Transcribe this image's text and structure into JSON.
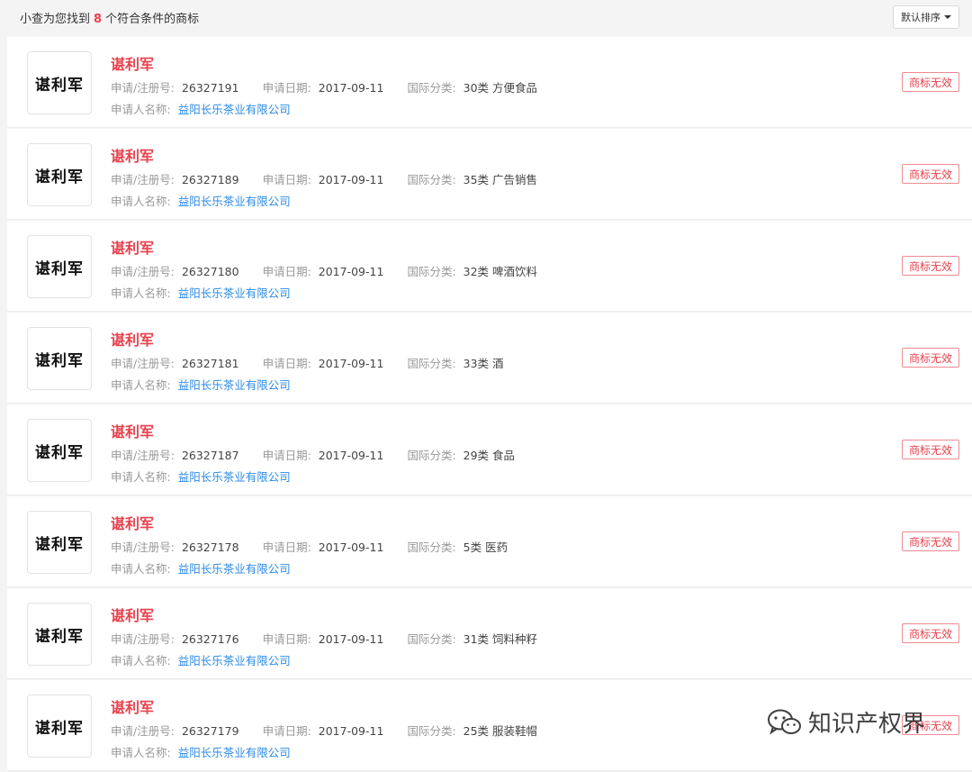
{
  "header": {
    "prefix": "小查为您找到",
    "count": "8",
    "suffix": "个符合条件的商标",
    "sort_label": "默认排序"
  },
  "labels": {
    "reg_no": "申请/注册号:",
    "date": "申请日期:",
    "class": "国际分类:",
    "applicant": "申请人名称:"
  },
  "items": [
    {
      "logo": "谌利军",
      "name": "谌利军",
      "reg_no": "26327191",
      "date": "2017-09-11",
      "class": "30类 方便食品",
      "applicant": "益阳长乐茶业有限公司",
      "status": "商标无效"
    },
    {
      "logo": "谌利军",
      "name": "谌利军",
      "reg_no": "26327189",
      "date": "2017-09-11",
      "class": "35类 广告销售",
      "applicant": "益阳长乐茶业有限公司",
      "status": "商标无效"
    },
    {
      "logo": "谌利军",
      "name": "谌利军",
      "reg_no": "26327180",
      "date": "2017-09-11",
      "class": "32类 啤酒饮料",
      "applicant": "益阳长乐茶业有限公司",
      "status": "商标无效"
    },
    {
      "logo": "谌利军",
      "name": "谌利军",
      "reg_no": "26327181",
      "date": "2017-09-11",
      "class": "33类 酒",
      "applicant": "益阳长乐茶业有限公司",
      "status": "商标无效"
    },
    {
      "logo": "谌利军",
      "name": "谌利军",
      "reg_no": "26327187",
      "date": "2017-09-11",
      "class": "29类 食品",
      "applicant": "益阳长乐茶业有限公司",
      "status": "商标无效"
    },
    {
      "logo": "谌利军",
      "name": "谌利军",
      "reg_no": "26327178",
      "date": "2017-09-11",
      "class": "5类 医药",
      "applicant": "益阳长乐茶业有限公司",
      "status": "商标无效"
    },
    {
      "logo": "谌利军",
      "name": "谌利军",
      "reg_no": "26327176",
      "date": "2017-09-11",
      "class": "31类 饲料种籽",
      "applicant": "益阳长乐茶业有限公司",
      "status": "商标无效"
    },
    {
      "logo": "谌利军",
      "name": "谌利军",
      "reg_no": "26327179",
      "date": "2017-09-11",
      "class": "25类 服装鞋帽",
      "applicant": "益阳长乐茶业有限公司",
      "status": "商标无效"
    }
  ],
  "watermark": {
    "icon": "wechat-icon",
    "text": "知识产权界"
  }
}
